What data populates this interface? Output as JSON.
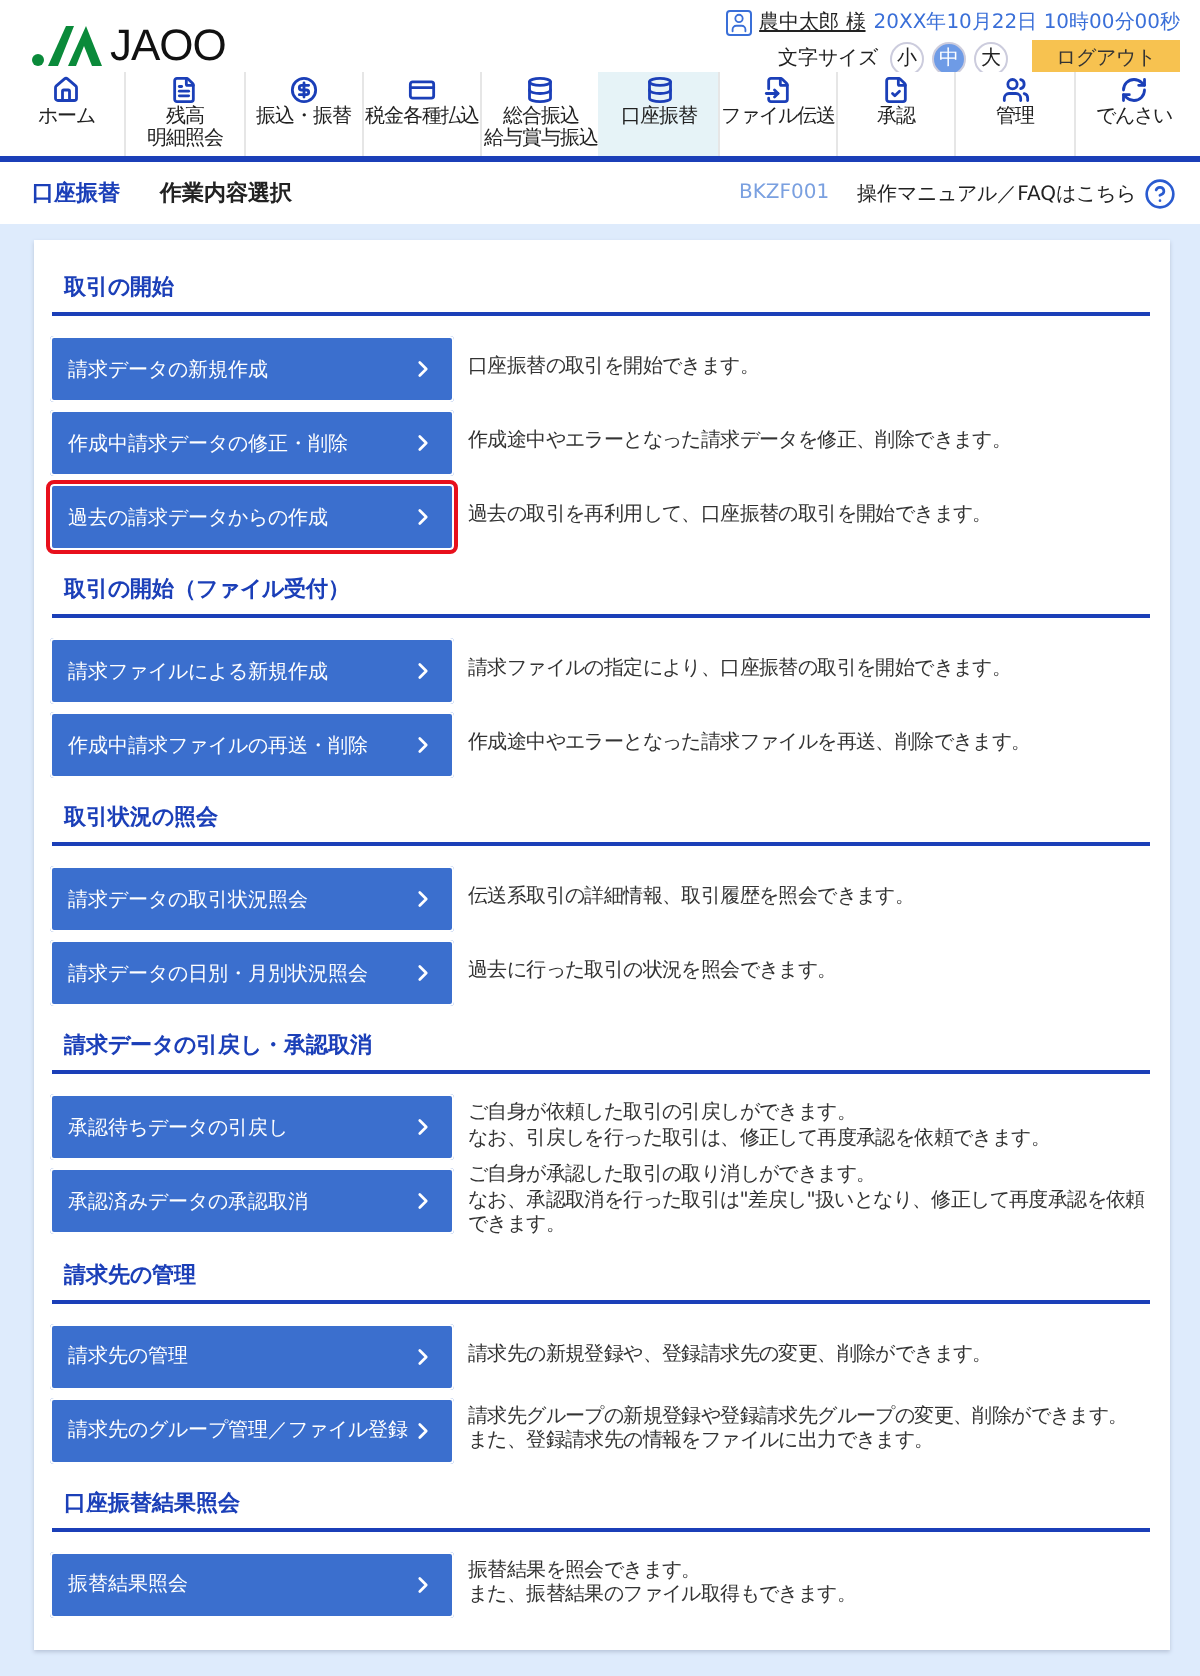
{
  "header": {
    "logo_text": "JAOO",
    "user_name": "農中太郎 様",
    "datetime": "20XX年10月22日 10時00分00秒",
    "font_size_label": "文字サイズ",
    "font_sizes": [
      {
        "label": "小",
        "selected": false
      },
      {
        "label": "中",
        "selected": true
      },
      {
        "label": "大",
        "selected": false
      }
    ],
    "logout": "ログアウト"
  },
  "nav": [
    {
      "lines": [
        "ホーム"
      ],
      "selected": false
    },
    {
      "lines": [
        "残高",
        "明細照会"
      ],
      "selected": false
    },
    {
      "lines": [
        "振込・振替"
      ],
      "selected": false
    },
    {
      "lines": [
        "税金各種払込"
      ],
      "selected": false
    },
    {
      "lines": [
        "総合振込",
        "給与賞与振込"
      ],
      "selected": false
    },
    {
      "lines": [
        "口座振替"
      ],
      "selected": true
    },
    {
      "lines": [
        "ファイル伝送"
      ],
      "selected": false
    },
    {
      "lines": [
        "承認"
      ],
      "selected": false
    },
    {
      "lines": [
        "管理"
      ],
      "selected": false
    },
    {
      "lines": [
        "でんさい"
      ],
      "selected": false
    }
  ],
  "breadcrumb": {
    "category": "口座振替",
    "page_title": "作業内容選択",
    "screen_id": "BKZF001",
    "help_link": "操作マニュアル／FAQはこちら"
  },
  "sections": [
    {
      "title": "取引の開始",
      "items": [
        {
          "label": "請求データの新規作成",
          "description": [
            "口座振替の取引を開始できます。"
          ],
          "highlighted": false
        },
        {
          "label": "作成中請求データの修正・削除",
          "description": [
            "作成途中やエラーとなった請求データを修正、削除できます。"
          ],
          "highlighted": false
        },
        {
          "label": "過去の請求データからの作成",
          "description": [
            "過去の取引を再利用して、口座振替の取引を開始できます。"
          ],
          "highlighted": true
        }
      ]
    },
    {
      "title": "取引の開始（ファイル受付）",
      "items": [
        {
          "label": "請求ファイルによる新規作成",
          "description": [
            "請求ファイルの指定により、口座振替の取引を開始できます。"
          ],
          "highlighted": false
        },
        {
          "label": "作成中請求ファイルの再送・削除",
          "description": [
            "作成途中やエラーとなった請求ファイルを再送、削除できます。"
          ],
          "highlighted": false
        }
      ]
    },
    {
      "title": "取引状況の照会",
      "items": [
        {
          "label": "請求データの取引状況照会",
          "description": [
            "伝送系取引の詳細情報、取引履歴を照会できます。"
          ],
          "highlighted": false
        },
        {
          "label": "請求データの日別・月別状況照会",
          "description": [
            "過去に行った取引の状況を照会できます。"
          ],
          "highlighted": false
        }
      ]
    },
    {
      "title": "請求データの引戻し・承認取消",
      "items": [
        {
          "label": "承認待ちデータの引戻し",
          "description": [
            "ご自身が依頼した取引の引戻しができます。",
            "なお、引戻しを行った取引は、修正して再度承認を依頼できます。"
          ],
          "highlighted": false
        },
        {
          "label": "承認済みデータの承認取消",
          "description": [
            "ご自身が承認した取引の取り消しができます。",
            "なお、承認取消を行った取引は\"差戻し\"扱いとなり、修正して再度承認を依頼できます。"
          ],
          "highlighted": false
        }
      ]
    },
    {
      "title": "請求先の管理",
      "items": [
        {
          "label": "請求先の管理",
          "description": [
            "請求先の新規登録や、登録請求先の変更、削除ができます。"
          ],
          "highlighted": false
        },
        {
          "label": "請求先のグループ管理／ファイル登録",
          "description": [
            "請求先グループの新規登録や登録請求先グループの変更、削除ができます。",
            "また、登録請求先の情報をファイルに出力できます。"
          ],
          "highlighted": false
        }
      ]
    },
    {
      "title": "口座振替結果照会",
      "items": [
        {
          "label": "振替結果照会",
          "description": [
            "振替結果を照会できます。",
            "また、振替結果のファイル取得もできます。"
          ],
          "highlighted": false
        }
      ]
    }
  ]
}
